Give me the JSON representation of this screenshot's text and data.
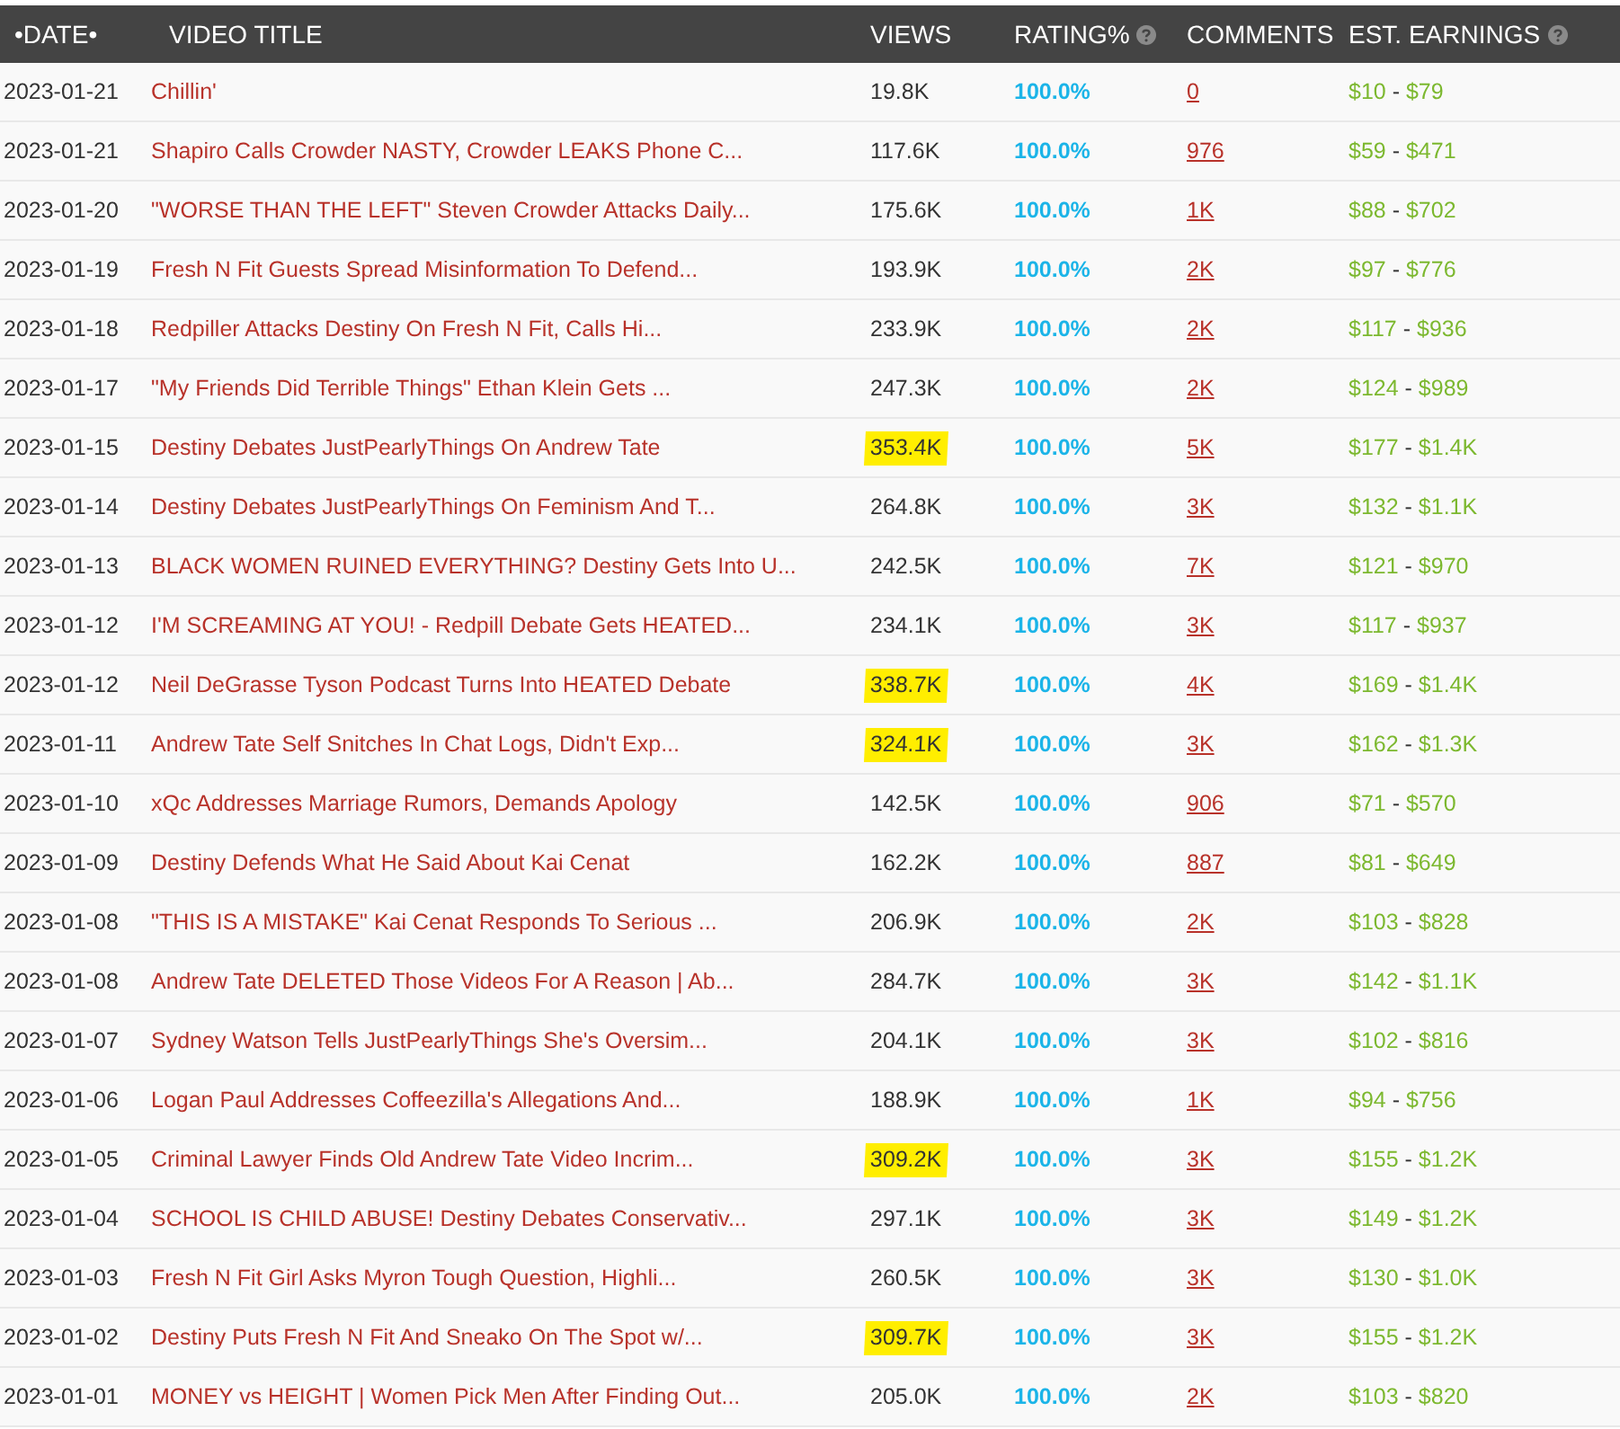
{
  "table": {
    "columns": [
      {
        "label": "•DATE•"
      },
      {
        "label": "VIDEO TITLE"
      },
      {
        "label": "VIEWS"
      },
      {
        "label": "RATING%",
        "help": true
      },
      {
        "label": "COMMENTS"
      },
      {
        "label": "EST. EARNINGS",
        "help": true
      }
    ],
    "rows": [
      {
        "date": "2023-01-21",
        "title": "Chillin'",
        "views": "19.8K",
        "highlighted": false,
        "rating": "100.0%",
        "comments": "0",
        "earnings": {
          "low": "$10",
          "sep": "-",
          "high": "$79"
        }
      },
      {
        "date": "2023-01-21",
        "title": "Shapiro Calls Crowder NASTY, Crowder LEAKS Phone C...",
        "views": "117.6K",
        "highlighted": false,
        "rating": "100.0%",
        "comments": "976",
        "earnings": {
          "low": "$59",
          "sep": "-",
          "high": "$471"
        }
      },
      {
        "date": "2023-01-20",
        "title": "\"WORSE THAN THE LEFT\" Steven Crowder Attacks Daily...",
        "views": "175.6K",
        "highlighted": false,
        "rating": "100.0%",
        "comments": "1K",
        "earnings": {
          "low": "$88",
          "sep": "-",
          "high": "$702"
        }
      },
      {
        "date": "2023-01-19",
        "title": "Fresh N Fit Guests Spread Misinformation To Defend...",
        "views": "193.9K",
        "highlighted": false,
        "rating": "100.0%",
        "comments": "2K",
        "earnings": {
          "low": "$97",
          "sep": "-",
          "high": "$776"
        }
      },
      {
        "date": "2023-01-18",
        "title": "Redpiller Attacks Destiny On Fresh N Fit, Calls Hi...",
        "views": "233.9K",
        "highlighted": false,
        "rating": "100.0%",
        "comments": "2K",
        "earnings": {
          "low": "$117",
          "sep": "-",
          "high": "$936"
        }
      },
      {
        "date": "2023-01-17",
        "title": "\"My Friends Did Terrible Things\" Ethan Klein Gets ...",
        "views": "247.3K",
        "highlighted": false,
        "rating": "100.0%",
        "comments": "2K",
        "earnings": {
          "low": "$124",
          "sep": "-",
          "high": "$989"
        }
      },
      {
        "date": "2023-01-15",
        "title": "Destiny Debates JustPearlyThings On Andrew Tate",
        "views": "353.4K",
        "highlighted": true,
        "rating": "100.0%",
        "comments": "5K",
        "earnings": {
          "low": "$177",
          "sep": "-",
          "high": "$1.4K"
        }
      },
      {
        "date": "2023-01-14",
        "title": "Destiny Debates JustPearlyThings On Feminism And T...",
        "views": "264.8K",
        "highlighted": false,
        "rating": "100.0%",
        "comments": "3K",
        "earnings": {
          "low": "$132",
          "sep": "-",
          "high": "$1.1K"
        }
      },
      {
        "date": "2023-01-13",
        "title": "BLACK WOMEN RUINED EVERYTHING? Destiny Gets Into U...",
        "views": "242.5K",
        "highlighted": false,
        "rating": "100.0%",
        "comments": "7K",
        "earnings": {
          "low": "$121",
          "sep": "-",
          "high": "$970"
        }
      },
      {
        "date": "2023-01-12",
        "title": "I'M SCREAMING AT YOU! - Redpill Debate Gets HEATED...",
        "views": "234.1K",
        "highlighted": false,
        "rating": "100.0%",
        "comments": "3K",
        "earnings": {
          "low": "$117",
          "sep": "-",
          "high": "$937"
        }
      },
      {
        "date": "2023-01-12",
        "title": "Neil DeGrasse Tyson Podcast Turns Into HEATED Debate",
        "views": "338.7K",
        "highlighted": true,
        "rating": "100.0%",
        "comments": "4K",
        "earnings": {
          "low": "$169",
          "sep": "-",
          "high": "$1.4K"
        }
      },
      {
        "date": "2023-01-11",
        "title": "Andrew Tate Self Snitches In Chat Logs, Didn't Exp...",
        "views": "324.1K",
        "highlighted": true,
        "rating": "100.0%",
        "comments": "3K",
        "earnings": {
          "low": "$162",
          "sep": "-",
          "high": "$1.3K"
        }
      },
      {
        "date": "2023-01-10",
        "title": "xQc Addresses Marriage Rumors, Demands Apology",
        "views": "142.5K",
        "highlighted": false,
        "rating": "100.0%",
        "comments": "906",
        "earnings": {
          "low": "$71",
          "sep": "-",
          "high": "$570"
        }
      },
      {
        "date": "2023-01-09",
        "title": "Destiny Defends What He Said About Kai Cenat",
        "views": "162.2K",
        "highlighted": false,
        "rating": "100.0%",
        "comments": "887",
        "earnings": {
          "low": "$81",
          "sep": "-",
          "high": "$649"
        }
      },
      {
        "date": "2023-01-08",
        "title": "\"THIS IS A MISTAKE\" Kai Cenat Responds To Serious ...",
        "views": "206.9K",
        "highlighted": false,
        "rating": "100.0%",
        "comments": "2K",
        "earnings": {
          "low": "$103",
          "sep": "-",
          "high": "$828"
        }
      },
      {
        "date": "2023-01-08",
        "title": "Andrew Tate DELETED Those Videos For A Reason | Ab...",
        "views": "284.7K",
        "highlighted": false,
        "rating": "100.0%",
        "comments": "3K",
        "earnings": {
          "low": "$142",
          "sep": "-",
          "high": "$1.1K"
        }
      },
      {
        "date": "2023-01-07",
        "title": "Sydney Watson Tells JustPearlyThings She's Oversim...",
        "views": "204.1K",
        "highlighted": false,
        "rating": "100.0%",
        "comments": "3K",
        "earnings": {
          "low": "$102",
          "sep": "-",
          "high": "$816"
        }
      },
      {
        "date": "2023-01-06",
        "title": "Logan Paul Addresses Coffeezilla's Allegations And...",
        "views": "188.9K",
        "highlighted": false,
        "rating": "100.0%",
        "comments": "1K",
        "earnings": {
          "low": "$94",
          "sep": "-",
          "high": "$756"
        }
      },
      {
        "date": "2023-01-05",
        "title": "Criminal Lawyer Finds Old Andrew Tate Video Incrim...",
        "views": "309.2K",
        "highlighted": true,
        "rating": "100.0%",
        "comments": "3K",
        "earnings": {
          "low": "$155",
          "sep": "-",
          "high": "$1.2K"
        }
      },
      {
        "date": "2023-01-04",
        "title": "SCHOOL IS CHILD ABUSE! Destiny Debates Conservativ...",
        "views": "297.1K",
        "highlighted": false,
        "rating": "100.0%",
        "comments": "3K",
        "earnings": {
          "low": "$149",
          "sep": "-",
          "high": "$1.2K"
        }
      },
      {
        "date": "2023-01-03",
        "title": "Fresh N Fit Girl Asks Myron Tough Question, Highli...",
        "views": "260.5K",
        "highlighted": false,
        "rating": "100.0%",
        "comments": "3K",
        "earnings": {
          "low": "$130",
          "sep": "-",
          "high": "$1.0K"
        }
      },
      {
        "date": "2023-01-02",
        "title": "Destiny Puts Fresh N Fit And Sneako On The Spot w/...",
        "views": "309.7K",
        "highlighted": true,
        "rating": "100.0%",
        "comments": "3K",
        "earnings": {
          "low": "$155",
          "sep": "-",
          "high": "$1.2K"
        }
      },
      {
        "date": "2023-01-01",
        "title": "MONEY vs HEIGHT | Women Pick Men After Finding Out...",
        "views": "205.0K",
        "highlighted": false,
        "rating": "100.0%",
        "comments": "2K",
        "earnings": {
          "low": "$103",
          "sep": "-",
          "high": "$820"
        }
      }
    ]
  }
}
